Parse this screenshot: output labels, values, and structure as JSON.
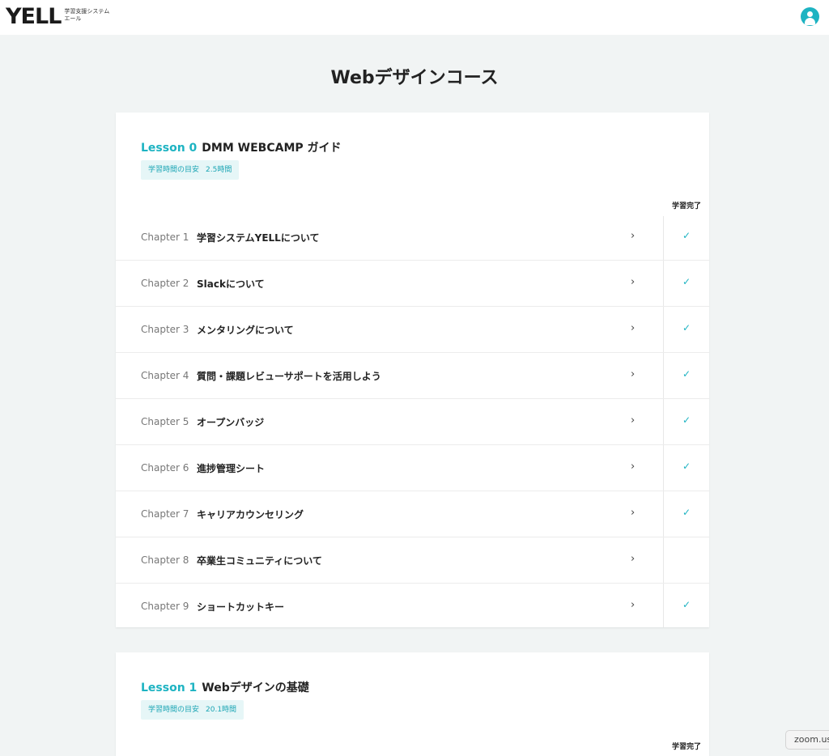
{
  "header": {
    "logo": {
      "mark": "YELL",
      "sub1": "学習支援システム",
      "sub2": "エール"
    },
    "avatar_icon": "user-avatar-icon"
  },
  "page": {
    "title": "Webデザインコース"
  },
  "lessons": [
    {
      "number": "Lesson 0",
      "name": "DMM WEBCAMP ガイド",
      "badge_label": "学習時間の目安",
      "badge_time": "2.5時間",
      "done_header": "学習完了",
      "chapters": [
        {
          "label": "Chapter 1",
          "title": "学習システムYELLについて",
          "chevron": "›",
          "check": "✓"
        },
        {
          "label": "Chapter 2",
          "title": "Slackについて",
          "chevron": "›",
          "check": "✓"
        },
        {
          "label": "Chapter 3",
          "title": "メンタリングについて",
          "chevron": "›",
          "check": "✓"
        },
        {
          "label": "Chapter 4",
          "title": "質問・課題レビューサポートを活用しよう",
          "chevron": "›",
          "check": "✓"
        },
        {
          "label": "Chapter 5",
          "title": "オープンバッジ",
          "chevron": "›",
          "check": "✓"
        },
        {
          "label": "Chapter 6",
          "title": "進捗管理シート",
          "chevron": "›",
          "check": "✓"
        },
        {
          "label": "Chapter 7",
          "title": "キャリアカウンセリング",
          "chevron": "›",
          "check": "✓"
        },
        {
          "label": "Chapter 8",
          "title": "卒業生コミュニティについて",
          "chevron": "›",
          "check": ""
        },
        {
          "label": "Chapter 9",
          "title": "ショートカットキー",
          "chevron": "›",
          "check": "✓"
        }
      ]
    },
    {
      "number": "Lesson 1",
      "name": "Webデザインの基礎",
      "badge_label": "学習時間の目安",
      "badge_time": "20.1時間",
      "done_header": "学習完了"
    }
  ],
  "tooltip": {
    "text": "zoom.us"
  },
  "colors": {
    "accent": "#1db3c2",
    "background": "#f1f4f4",
    "badge_bg": "#e6f6f7"
  }
}
